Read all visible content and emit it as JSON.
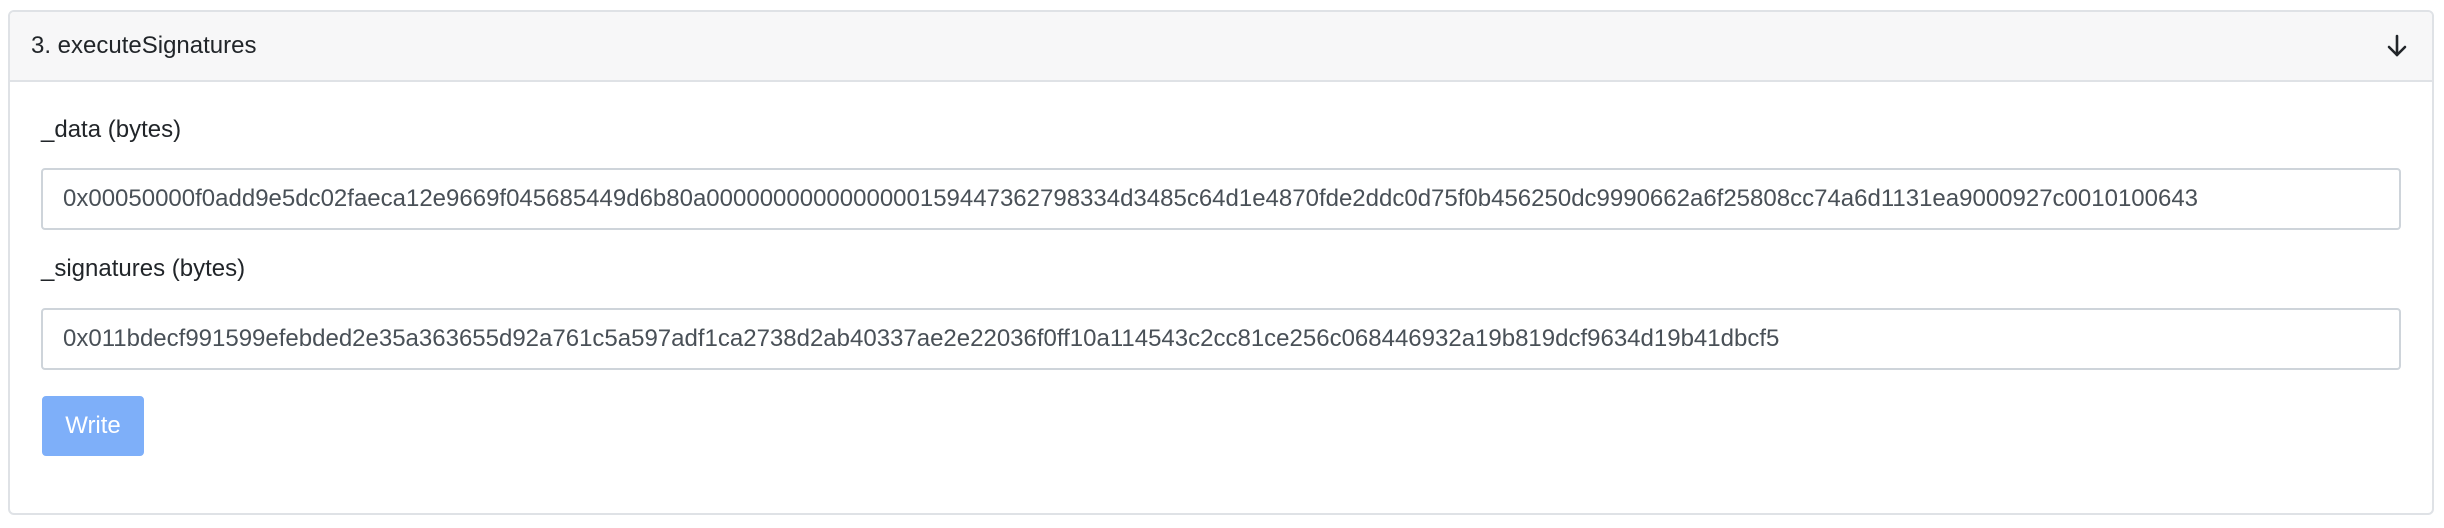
{
  "function": {
    "title": "3. executeSignatures",
    "toggle_icon": "arrow-down-icon"
  },
  "fields": [
    {
      "label": "_data (bytes)",
      "value": "0x00050000f0add9e5dc02faeca12e9669f045685449d6b80a0000000000000000159447362798334d3485c64d1e4870fde2ddc0d75f0b456250dc9990662a6f25808cc74a6d1131ea9000927c0010100643"
    },
    {
      "label": "_signatures (bytes)",
      "value": "0x011bdecf991599efebded2e35a363655d92a761c5a597adf1ca2738d2ab40337ae2e22036f0ff10a114543c2cc81ce256c068446932a19b819dcf9634d19b41dbcf5"
    }
  ],
  "actions": {
    "write_label": "Write",
    "write_color": "#7eaff9"
  }
}
